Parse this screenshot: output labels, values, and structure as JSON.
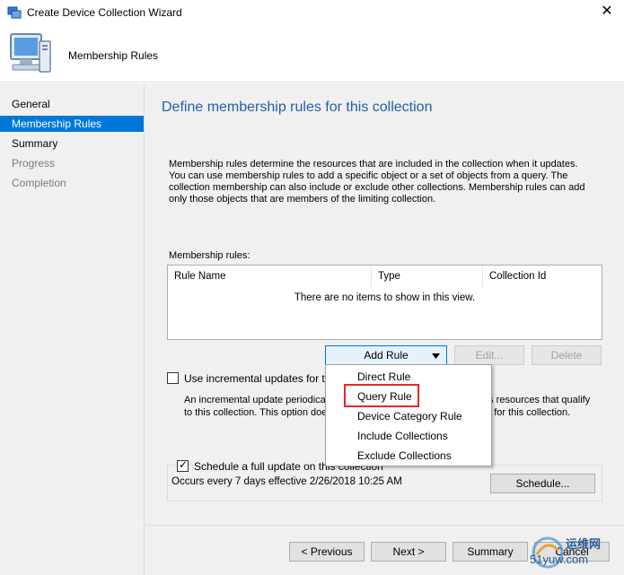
{
  "window": {
    "title": "Create Device Collection Wizard",
    "close_glyph": "✕"
  },
  "header": {
    "title": "Membership Rules"
  },
  "sidebar": {
    "items": [
      {
        "label": "General",
        "state": "normal"
      },
      {
        "label": "Membership Rules",
        "state": "active"
      },
      {
        "label": "Summary",
        "state": "normal"
      },
      {
        "label": "Progress",
        "state": "disabled"
      },
      {
        "label": "Completion",
        "state": "disabled"
      }
    ]
  },
  "main": {
    "heading": "Define membership rules for this collection",
    "description": "Membership rules determine the resources that are included in the collection when it updates. You can use membership rules to add a specific object or a set of objects from a query. The collection membership can also include or exclude other collections. Membership rules can add only those objects that are members of the limiting collection.",
    "rules_label": "Membership rules:",
    "columns": [
      "Rule Name",
      "Type",
      "Collection Id"
    ],
    "empty_message": "There are no items to show in this view.",
    "add_rule_label": "Add Rule",
    "edit_label": "Edit...",
    "delete_label": "Delete",
    "incremental_label": "Use incremental updates for this c",
    "incremental_checked": false,
    "incremental_desc_left_1": "An incremental update periodical",
    "incremental_desc_left_2": "to this collection. This option doe",
    "incremental_desc_right_1": "ds resources that qualify",
    "incremental_desc_right_2": "te for this collection.",
    "schedule_label": "Schedule a full update on this collection",
    "schedule_checked": true,
    "schedule_text": "Occurs every 7 days effective 2/26/2018 10:25 AM",
    "schedule_button": "Schedule..."
  },
  "add_rule_menu": {
    "items": [
      "Direct Rule",
      "Query Rule",
      "Device Category Rule",
      "Include Collections",
      "Exclude Collections"
    ],
    "highlighted": "Query Rule"
  },
  "footer": {
    "previous_label": "< Previous",
    "next_label": "Next >",
    "summary_label": "Summary",
    "cancel_label": "Cancel"
  },
  "watermark": {
    "line1": "运维网",
    "line2": "51yuw.com"
  },
  "colors": {
    "accent": "#0078d7",
    "heading": "#1f5fa8",
    "highlight": "#e8262b",
    "panel": "#f0f0f0"
  }
}
